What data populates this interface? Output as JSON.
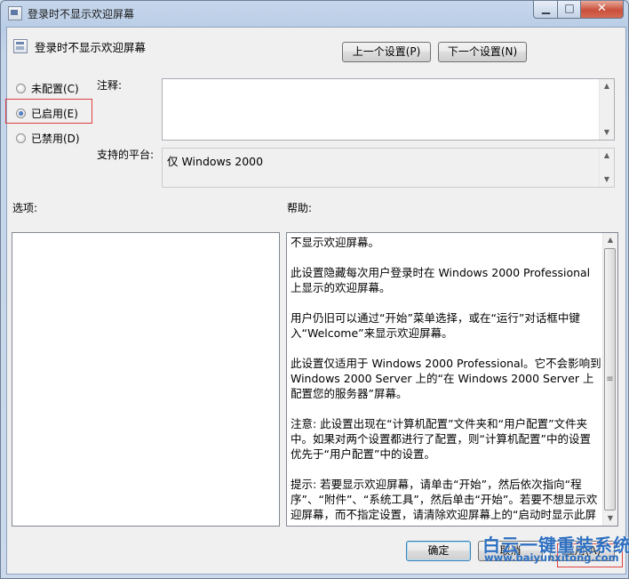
{
  "window": {
    "title": "登录时不显示欢迎屏幕"
  },
  "caption": {
    "minimize": "▁",
    "maximize": "□",
    "close": "✕"
  },
  "policy": {
    "name": "登录时不显示欢迎屏幕"
  },
  "nav": {
    "prev": "上一个设置(P)",
    "next": "下一个设置(N)"
  },
  "options": {
    "not_configured": "未配置(C)",
    "enabled": "已启用(E)",
    "disabled": "已禁用(D)",
    "selected": "enabled"
  },
  "labels": {
    "comment": "注释:",
    "platform": "支持的平台:",
    "options": "选项:",
    "help": "帮助:"
  },
  "comment_value": "",
  "platform_value": "仅 Windows 2000",
  "help": {
    "paragraphs": [
      "不显示欢迎屏幕。",
      "此设置隐藏每次用户登录时在 Windows 2000 Professional 上显示的欢迎屏幕。",
      "用户仍旧可以通过“开始”菜单选择，或在“运行”对话框中键入“Welcome”来显示欢迎屏幕。",
      "此设置仅适用于 Windows 2000 Professional。它不会影响到 Windows 2000 Server 上的“在 Windows 2000 Server 上配置您的服务器”屏幕。",
      "注意: 此设置出现在“计算机配置”文件夹和“用户配置”文件夹中。如果对两个设置都进行了配置，则“计算机配置”中的设置优先于“用户配置”中的设置。",
      "提示: 若要显示欢迎屏幕，请单击“开始”，然后依次指向“程序”、“附件”、“系统工具”，然后单击“开始”。若要不想显示欢迎屏幕，而不指定设置，请清除欢迎屏幕上的“启动时显示此屏"
    ]
  },
  "footer": {
    "ok": "确定",
    "cancel": "取消",
    "apply": "应用(A)"
  },
  "watermark": {
    "title": "白云一键重装系统",
    "url": "www.baiyunxitong.com"
  },
  "colors": {
    "highlight": "#e04040",
    "watermark": "#2d6fc0"
  }
}
